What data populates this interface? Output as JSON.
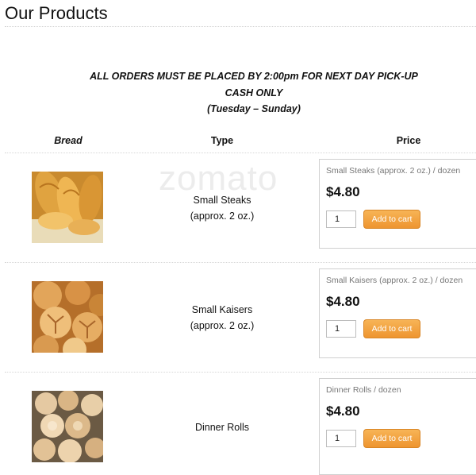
{
  "page": {
    "title": "Our Products"
  },
  "notice": {
    "line1": "ALL ORDERS MUST BE PLACED BY 2:00pm FOR NEXT DAY PICK-UP",
    "line2": "CASH ONLY",
    "line3": "(Tuesday – Sunday)"
  },
  "table": {
    "headers": {
      "bread": "Bread",
      "type": "Type",
      "price": "Price"
    }
  },
  "products": [
    {
      "type_line1": "Small Steaks",
      "type_line2": "(approx. 2 oz.)",
      "name": "Small Steaks (approx. 2 oz.) / dozen",
      "price": "$4.80",
      "quantity": "1",
      "button": "Add to cart"
    },
    {
      "type_line1": "Small Kaisers",
      "type_line2": "(approx. 2 oz.)",
      "name": "Small Kaisers (approx. 2 oz.) / dozen",
      "price": "$4.80",
      "quantity": "1",
      "button": "Add to cart"
    },
    {
      "type_line1": "Dinner Rolls",
      "type_line2": "",
      "name": "Dinner Rolls / dozen",
      "price": "$4.80",
      "quantity": "1",
      "button": "Add to cart"
    }
  ],
  "colors": {
    "button": "#ee9530",
    "button_border": "#d98626",
    "muted_text": "#777777"
  }
}
